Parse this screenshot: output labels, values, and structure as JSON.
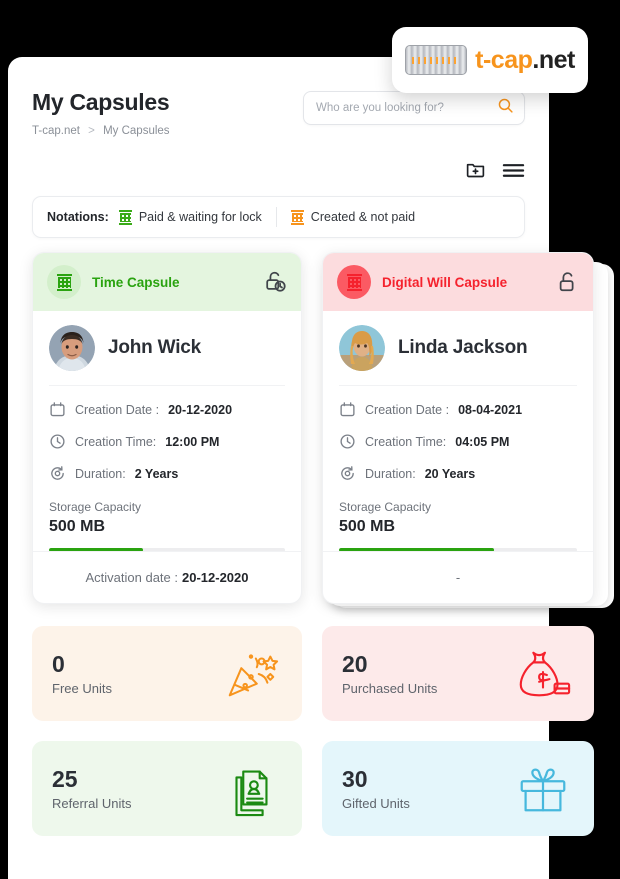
{
  "logo": {
    "name_accent": "t-cap",
    "name_rest": ".net",
    "icon": "capsule-logo-icon"
  },
  "header": {
    "title": "My Capsules",
    "breadcrumb": {
      "root": "T-cap.net",
      "separator": ">",
      "current": "My Capsules"
    },
    "search": {
      "placeholder": "Who are you looking for?",
      "value": "",
      "icon": "search-icon"
    },
    "toolbar": {
      "add_icon": "add-folder-icon",
      "menu_icon": "hamburger-menu-icon"
    }
  },
  "notations": {
    "label": "Notations:",
    "items": [
      {
        "icon": "capsule-icon",
        "text": "Paid & waiting for lock",
        "color": "#3aab18"
      },
      {
        "icon": "capsule-icon",
        "text": "Created & not paid",
        "color": "#f7941d"
      }
    ]
  },
  "labels": {
    "creation_date": "Creation Date :",
    "creation_time": "Creation Time:",
    "duration": "Duration:",
    "storage_capacity": "Storage Capacity",
    "activation_date": "Activation date :"
  },
  "cards": [
    {
      "type": "Time Capsule",
      "accent": "#2aa310",
      "head_bg": "#e4f5df",
      "badge_bg": "#d3efcb",
      "lock_icon": "unlock-clock-icon",
      "capsule_icon": "capsule-icon",
      "person": {
        "name": "John Wick",
        "avatar": "avatar-john-wick"
      },
      "creation_date": "20-12-2020",
      "creation_time": "12:00 PM",
      "duration": "2 Years",
      "storage": "500 MB",
      "progress": 40,
      "footer_prefix": "Activation date :",
      "footer_value": "20-12-2020"
    },
    {
      "type": "Digital Will Capsule",
      "accent": "#f5222d",
      "head_bg": "#fcdcde",
      "badge_bg": "#fb5a63",
      "lock_icon": "unlock-icon",
      "capsule_icon": "capsule-icon",
      "person": {
        "name": "Linda Jackson",
        "avatar": "avatar-linda-jackson"
      },
      "creation_date": "08-04-2021",
      "creation_time": "04:05 PM",
      "duration": "20 Years",
      "storage": "500 MB",
      "progress": 65,
      "footer_prefix": "",
      "footer_value": "-"
    }
  ],
  "tiles": [
    {
      "number": "0",
      "label": "Free Units",
      "bg": "#fdf3e9",
      "color": "#f7941d",
      "icon": "party-popper-icon"
    },
    {
      "number": "20",
      "label": "Purchased Units",
      "bg": "#fdeaea",
      "color": "#f5222d",
      "icon": "money-bag-icon"
    },
    {
      "number": "25",
      "label": "Referral Units",
      "bg": "#eef8ec",
      "color": "#1b8a12",
      "icon": "documents-person-icon"
    },
    {
      "number": "30",
      "label": "Gifted Units",
      "bg": "#e4f6fb",
      "color": "#46b8dd",
      "icon": "gift-box-icon"
    }
  ]
}
